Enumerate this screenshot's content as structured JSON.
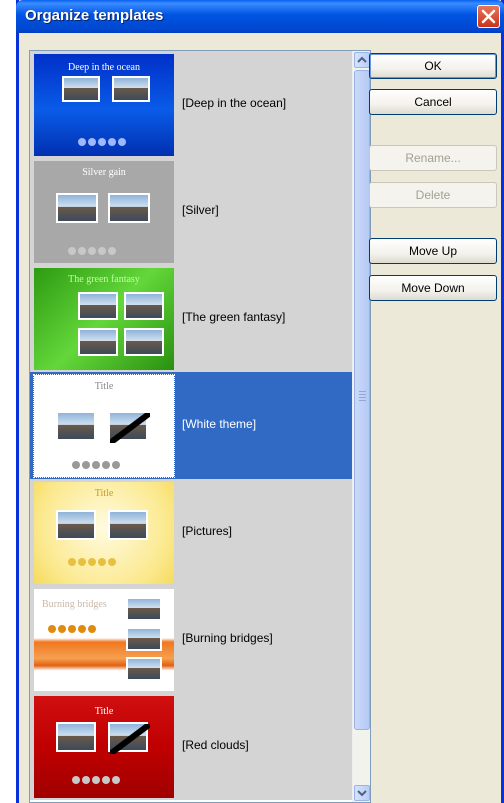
{
  "window": {
    "title": "Organize templates"
  },
  "templates": [
    {
      "label": "[Deep in the ocean]",
      "thumb_title": "Deep in the ocean",
      "theme": "ocean"
    },
    {
      "label": "[Silver]",
      "thumb_title": "Silver gain",
      "theme": "silver"
    },
    {
      "label": "[The green fantasy]",
      "thumb_title": "The green fantasy",
      "theme": "green"
    },
    {
      "label": "[White theme]",
      "thumb_title": "Title",
      "theme": "white",
      "selected": true
    },
    {
      "label": "[Pictures]",
      "thumb_title": "Title",
      "theme": "pictures"
    },
    {
      "label": "[Burning bridges]",
      "thumb_title": "Burning bridges",
      "theme": "burning"
    },
    {
      "label": "[Red clouds]",
      "thumb_title": "Title",
      "theme": "red"
    }
  ],
  "buttons": {
    "ok": "OK",
    "cancel": "Cancel",
    "rename": "Rename...",
    "delete": "Delete",
    "move_up": "Move Up",
    "move_down": "Move Down"
  },
  "colors": {
    "titlebar": "#0054e3",
    "selection": "#316ac5",
    "item_background": "#d4d4d4"
  }
}
